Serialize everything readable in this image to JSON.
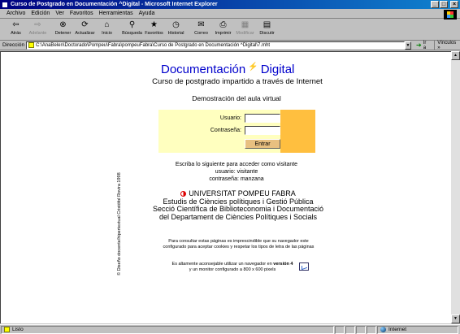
{
  "window": {
    "title": "Curso de Postgrado en Documentación ^Digital - Microsoft Internet Explorer",
    "buttons": {
      "minimize": "_",
      "maximize": "□",
      "close": "×"
    }
  },
  "menu": [
    "Archivo",
    "Edición",
    "Ver",
    "Favoritos",
    "Herramientas",
    "Ayuda"
  ],
  "toolbar": [
    {
      "label": "Atrás",
      "icon": "back-arrow-icon",
      "glyph": "⇦",
      "enabled": true
    },
    {
      "label": "Adelante",
      "icon": "forward-arrow-icon",
      "glyph": "⇨",
      "enabled": false
    },
    {
      "label": "Detener",
      "icon": "stop-icon",
      "glyph": "⊗",
      "enabled": true
    },
    {
      "label": "Actualizar",
      "icon": "refresh-icon",
      "glyph": "⟳",
      "enabled": true
    },
    {
      "label": "Inicio",
      "icon": "home-icon",
      "glyph": "⌂",
      "enabled": true
    },
    {
      "label": "Búsqueda",
      "icon": "search-icon",
      "glyph": "⚲",
      "enabled": true
    },
    {
      "label": "Favoritos",
      "icon": "favorites-icon",
      "glyph": "★",
      "enabled": true
    },
    {
      "label": "Historial",
      "icon": "history-icon",
      "glyph": "◷",
      "enabled": true
    },
    {
      "label": "Correo",
      "icon": "mail-icon",
      "glyph": "✉",
      "enabled": true
    },
    {
      "label": "Imprimir",
      "icon": "print-icon",
      "glyph": "⎙",
      "enabled": true
    },
    {
      "label": "Modificar",
      "icon": "edit-icon",
      "glyph": "▦",
      "enabled": false
    },
    {
      "label": "Discutir",
      "icon": "discuss-icon",
      "glyph": "▤",
      "enabled": true
    }
  ],
  "address": {
    "label": "Dirección",
    "url": "C:\\AnaBelen\\Doctorado\\Pompeu\\Fabra\\pompeuFabra\\Curso de Postgrado en Documentación ^Digital\\7.mht",
    "go_label": "Ir a",
    "links_label": "Vínculos »"
  },
  "page": {
    "side_credit": "© Diseño docente/hipertextual Cristòfol Rovira 1998",
    "brand_left": "Documentación",
    "brand_bolt": "⚡",
    "brand_right": "Digital",
    "subtitle": "Curso de postgrado impartido a través de Internet",
    "demo_heading": "Demostración del aula virtual",
    "login": {
      "user_label": "Usuario:",
      "user_value": "",
      "pass_label": "Contraseña:",
      "pass_value": "",
      "submit_label": "Entrar"
    },
    "instructions": [
      "Escriba lo siguiente para acceder como visitante",
      "usuario: visitante",
      "contraseña: manzana"
    ],
    "university": [
      "UNIVERSITAT POMPEU FABRA",
      "Estudis de Ciències polítiques i Gestió Pública",
      "Secció Científica de Biblioteconomia i Documentació",
      "del Departament de Ciències Polítiques i Socials"
    ],
    "note_cookies": [
      "Para consultar estas páginas es imprescindible que su navegador este",
      "configurado para aceptar cookies y respetar los tipos de letra de las páginas"
    ],
    "note_browser_a": "Es altamente aconsejable utilizar un navegador en ",
    "note_browser_bold": "versión 4",
    "note_browser_b": "y un monitor configurado a 800 x 600 pixels"
  },
  "status": {
    "left": "Listo",
    "zone": "Internet"
  }
}
